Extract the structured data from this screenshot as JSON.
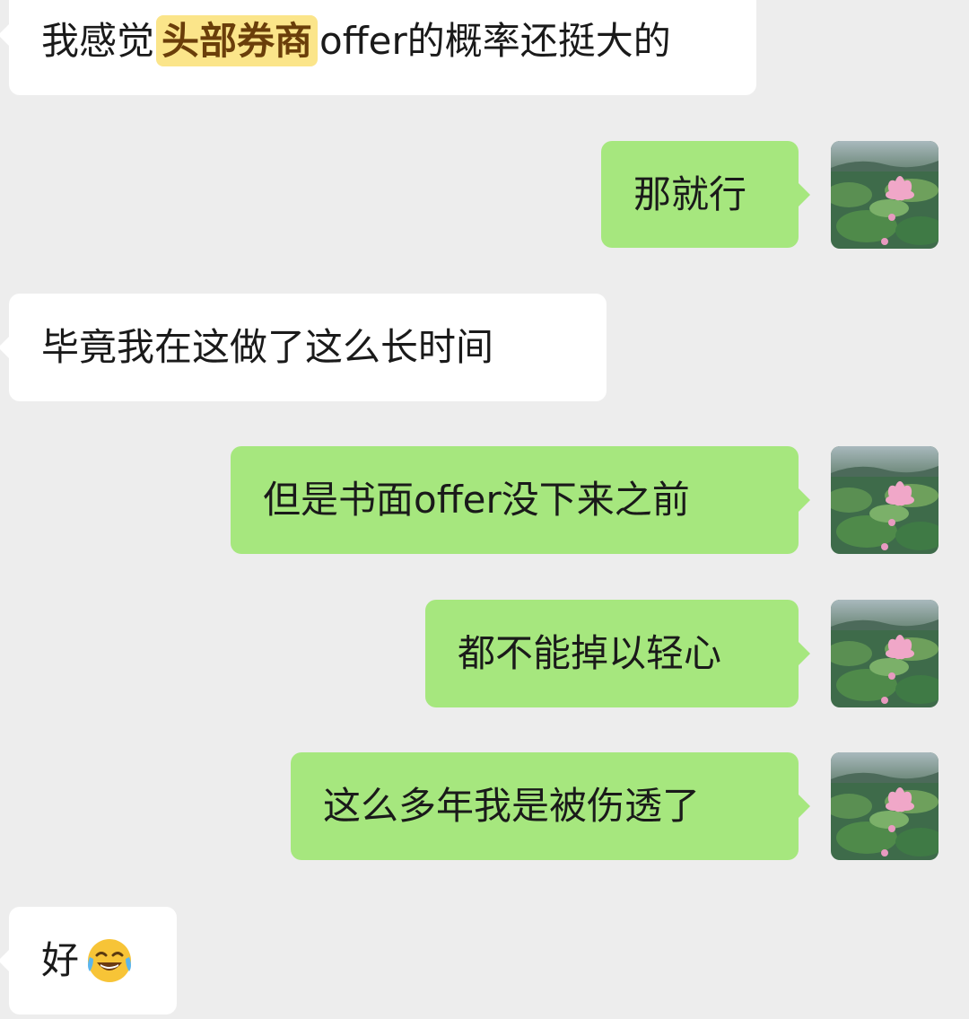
{
  "messages": [
    {
      "side": "in",
      "pre": "我感觉",
      "highlight": "头部券商",
      "post": "offer的概率还挺大的"
    },
    {
      "side": "out",
      "text": "那就行"
    },
    {
      "side": "in",
      "text": "毕竟我在这做了这么长时间"
    },
    {
      "side": "out",
      "text": "但是书面offer没下来之前"
    },
    {
      "side": "out",
      "text": "都不能掉以轻心"
    },
    {
      "side": "out",
      "text": "这么多年我是被伤透了"
    },
    {
      "side": "in",
      "text": "好",
      "emoji": "tears-of-joy-emoji"
    }
  ],
  "colors": {
    "background": "#ededed",
    "incoming_bubble": "#ffffff",
    "outgoing_bubble": "#a6e77e",
    "highlight": "#fbe58a"
  },
  "avatar": {
    "icon": "lotus-pond-avatar"
  }
}
